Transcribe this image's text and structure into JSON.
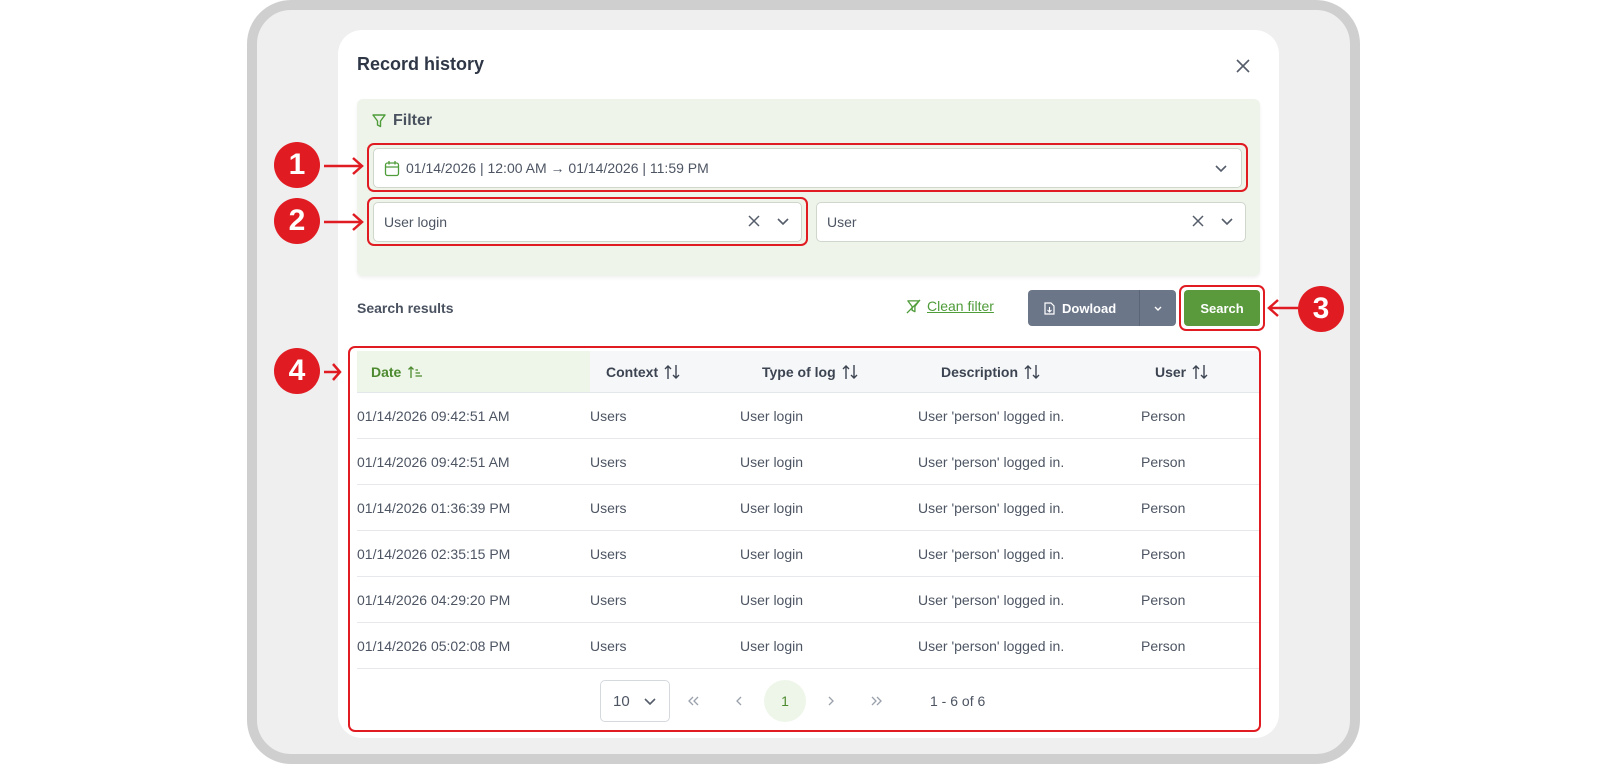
{
  "modal": {
    "title": "Record history"
  },
  "filter": {
    "heading": "Filter",
    "date_range": "01/14/2026 | 12:00 AM → 01/14/2026 | 11:59 PM",
    "type_select": "User login",
    "user_select": "User"
  },
  "results": {
    "label": "Search results"
  },
  "toolbar": {
    "clean_filter": "Clean filter",
    "download": "Dowload",
    "search": "Search"
  },
  "callouts": [
    "1",
    "2",
    "3",
    "4"
  ],
  "table": {
    "columns": [
      "Date",
      "Context",
      "Type of log",
      "Description",
      "User"
    ],
    "rows": [
      [
        "01/14/2026 09:42:51 AM",
        "Users",
        "User login",
        "User 'person' logged in.",
        "Person"
      ],
      [
        "01/14/2026 09:42:51 AM",
        "Users",
        "User login",
        "User 'person' logged in.",
        "Person"
      ],
      [
        "01/14/2026 01:36:39 PM",
        "Users",
        "User login",
        "User 'person' logged in.",
        "Person"
      ],
      [
        "01/14/2026 02:35:15 PM",
        "Users",
        "User login",
        "User 'person' logged in.",
        "Person"
      ],
      [
        "01/14/2026 04:29:20 PM",
        "Users",
        "User login",
        "User 'person' logged in.",
        "Person"
      ],
      [
        "01/14/2026 05:02:08 PM",
        "Users",
        "User login",
        "User 'person' logged in.",
        "Person"
      ]
    ]
  },
  "pagination": {
    "page_size": "10",
    "current_page": "1",
    "info": "1 - 6 of 6"
  },
  "colors": {
    "accent_green": "#5a9a3c",
    "callout_red": "#e11b22",
    "download_gray": "#6b7689"
  }
}
